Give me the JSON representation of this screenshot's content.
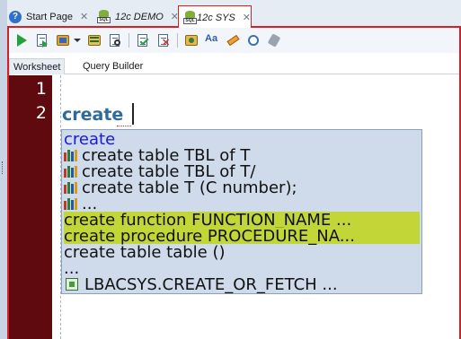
{
  "tabs": [
    {
      "label": "Start Page",
      "icon": "help-icon",
      "active": false
    },
    {
      "label": "12c DEMO",
      "icon": "sql-worksheet-icon",
      "active": false
    },
    {
      "label": "12c SYS",
      "icon": "sql-worksheet-icon",
      "active": true
    }
  ],
  "toolbar": {
    "icons": [
      "run-statement-icon",
      "run-script-icon",
      "autotrace-icon",
      "explain-plan-icon",
      "sql-tuning-icon",
      "commit-icon",
      "rollback-icon",
      "unshared-sql-icon",
      "change-case-icon",
      "clear-icon",
      "sql-history-icon",
      "tools-icon"
    ],
    "change_case_glyph": "Aa"
  },
  "subtabs": [
    {
      "label": "Worksheet",
      "active": true
    },
    {
      "label": "Query Builder",
      "active": false
    }
  ],
  "editor": {
    "line_numbers": [
      "1",
      "2"
    ],
    "code": "create"
  },
  "completion": {
    "items": [
      {
        "text": "create",
        "kind": "keyword"
      },
      {
        "text": "create table TBL of T",
        "kind": "snippet"
      },
      {
        "text": "create table TBL of T/",
        "kind": "snippet"
      },
      {
        "text": "create table T (C number);",
        "kind": "snippet"
      },
      {
        "text": "...",
        "kind": "snippet"
      },
      {
        "text": "create function FUNCTION_NAME ...",
        "kind": "highlighted"
      },
      {
        "text": "create procedure PROCEDURE_NA...",
        "kind": "highlighted"
      },
      {
        "text": "create table table ()",
        "kind": "plain"
      },
      {
        "text": "...",
        "kind": "plain"
      },
      {
        "text": "LBACSYS.CREATE_OR_FETCH ...",
        "kind": "package"
      }
    ]
  },
  "colors": {
    "accent_red": "#d81f26",
    "gutter": "#5e0a0f",
    "keyword_blue": "#2e6a9e",
    "highlight": "#c2d638",
    "popup_bg": "#cfdaea"
  }
}
